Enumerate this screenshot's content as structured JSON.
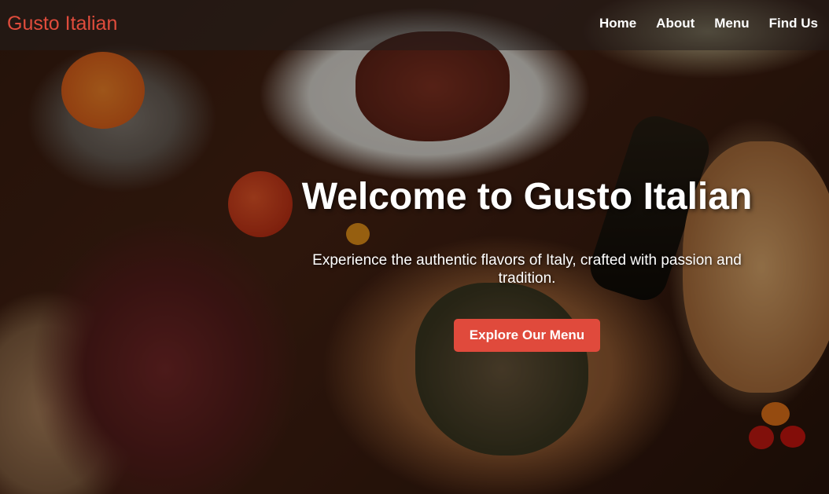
{
  "header": {
    "brand": "Gusto Italian",
    "nav": [
      "Home",
      "About",
      "Menu",
      "Find Us"
    ]
  },
  "hero": {
    "title": "Welcome to Gusto Italian",
    "subtitle": "Experience the authentic flavors of Italy, crafted with passion and tradition.",
    "cta_label": "Explore Our Menu"
  },
  "colors": {
    "brand": "#e04c3c",
    "cta_background": "#e04a3c",
    "header_overlay": "rgba(35,30,28,0.55)",
    "text": "#ffffff"
  }
}
